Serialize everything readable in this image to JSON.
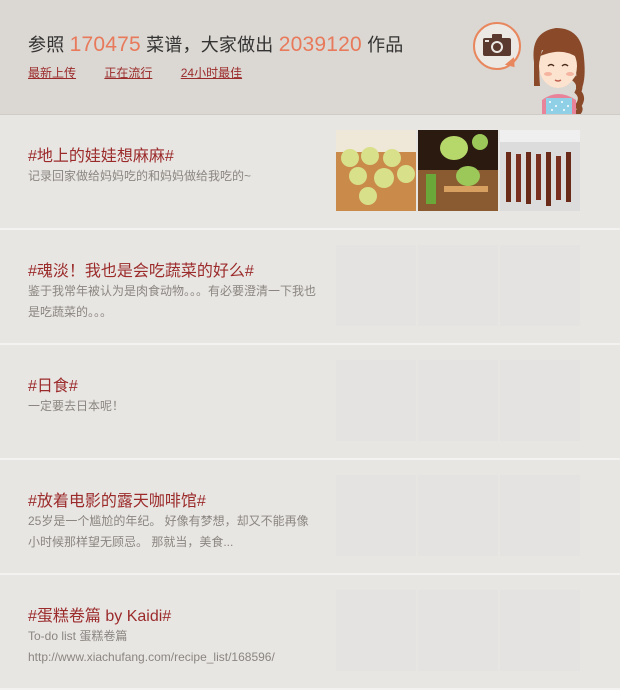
{
  "header": {
    "prefix": "参照",
    "recipe_count": "170475",
    "middle": "菜谱，大家做出",
    "works_count": "2039120",
    "suffix": "作品",
    "links": [
      "最新上传",
      "正在流行",
      "24小时最佳"
    ]
  },
  "icons": {
    "camera": "camera-icon",
    "mascot": "girl-avatar"
  },
  "colors": {
    "accent": "#e8795a",
    "title": "#9b2b2b",
    "header_bg": "#dbd7d2",
    "row_bg": "#e8e6e3"
  },
  "rows": [
    {
      "title": "#地上的娃娃想麻麻#",
      "desc": "记录回家做给妈妈吃的和妈妈做给我吃的~",
      "thumbs_loaded": true
    },
    {
      "title": "#魂淡！我也是会吃蔬菜的好么#",
      "desc": "鉴于我常年被认为是肉食动物。。。有必要澄清一下我也是吃蔬菜的。。。",
      "thumbs_loaded": false
    },
    {
      "title": "#日食#",
      "desc": "一定要去日本呢！",
      "thumbs_loaded": false
    },
    {
      "title": "#放着电影的露天咖啡馆#",
      "desc": "25岁是一个尴尬的年纪。 好像有梦想，却又不能再像小时候那样望无顾忌。 那就当，美食...",
      "thumbs_loaded": false
    },
    {
      "title": "#蛋糕卷篇 by Kaidi#",
      "desc": "To-do list 蛋糕卷篇 http://www.xiachufang.com/recipe_list/168596/",
      "thumbs_loaded": false
    }
  ]
}
